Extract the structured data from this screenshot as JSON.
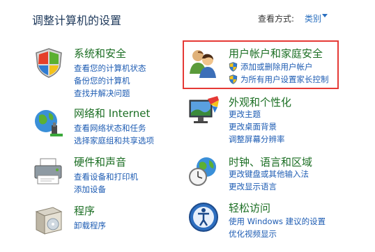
{
  "header": {
    "title": "调整计算机的设置",
    "view_by_label": "查看方式:",
    "view_by_value": "类别"
  },
  "left_categories": [
    {
      "title": "系统和安全",
      "icon": "shield-flag-icon",
      "links": [
        "查看您的计算机状态",
        "备份您的计算机",
        "查找并解决问题"
      ]
    },
    {
      "title": "网络和 Internet",
      "icon": "globe-network-icon",
      "links": [
        "查看网络状态和任务",
        "选择家庭组和共享选项"
      ]
    },
    {
      "title": "硬件和声音",
      "icon": "printer-icon",
      "links": [
        "查看设备和打印机",
        "添加设备"
      ]
    },
    {
      "title": "程序",
      "icon": "programs-box-icon",
      "links": [
        "卸载程序"
      ]
    }
  ],
  "right_categories": [
    {
      "title": "用户帐户和家庭安全",
      "icon": "users-icon",
      "links": [
        "添加或删除用户帐户",
        "为所有用户设置家长控制"
      ],
      "shield_links": true
    },
    {
      "title": "外观和个性化",
      "icon": "monitor-paint-icon",
      "links": [
        "更改主题",
        "更改桌面背景",
        "调整屏幕分辨率"
      ]
    },
    {
      "title": "时钟、语言和区域",
      "icon": "clock-globe-icon",
      "links": [
        "更改键盘或其他输入法",
        "更改显示语言"
      ]
    },
    {
      "title": "轻松访问",
      "icon": "ease-of-access-icon",
      "links": [
        "使用 Windows 建议的设置",
        "优化视频显示"
      ]
    }
  ],
  "colors": {
    "title_green": "#1b6e23",
    "link_blue": "#1e5cb3",
    "highlight_red": "#e53935"
  }
}
